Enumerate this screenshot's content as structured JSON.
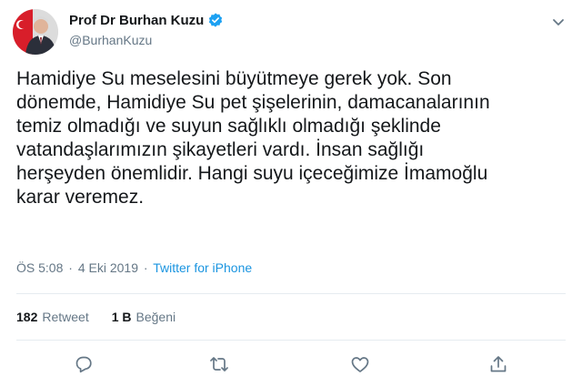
{
  "tweet": {
    "author": {
      "display_name": "Prof Dr Burhan Kuzu",
      "handle": "@BurhanKuzu",
      "verified": true
    },
    "text": "Hamidiye Su meselesini büyütmeye gerek yok. Son\ndönemde, Hamidiye Su pet şişelerinin, damacanalarının\ntemiz olmadığı ve suyun sağlıklı olmadığı şeklinde\nvatandaşlarımızın şikayetleri vardı. İnsan sağlığı\nherşeyden önemlidir. Hangi suyu içeceğimize İmamoğlu\nkarar veremez.",
    "time": "ÖS 5:08",
    "separator": "·",
    "date": "4 Eki 2019",
    "source": "Twitter for iPhone",
    "stats": {
      "retweets_count": "182",
      "retweets_label": "Retweet",
      "likes_count": "1 B",
      "likes_label": "Beğeni"
    },
    "actions": [
      "reply-icon",
      "retweet-icon",
      "like-icon",
      "share-icon"
    ]
  },
  "colors": {
    "text": "#14171a",
    "secondary": "#657786",
    "link": "#1b95e0",
    "divider": "#e6ecf0",
    "verified": "#1da1f2"
  }
}
